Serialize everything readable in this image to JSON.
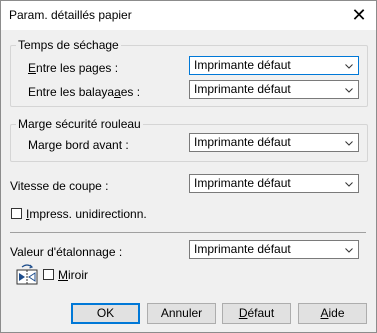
{
  "window": {
    "title": "Param. détaillés papier",
    "close_glyph": "✕"
  },
  "drying": {
    "group_title": "Temps de séchage",
    "between_pages_label": "Entre les pages :",
    "between_pages_value": "Imprimante défaut",
    "between_scans_label": "Entre les balayages :",
    "between_scans_value": "Imprimante défaut"
  },
  "margin": {
    "group_title": "Marge sécurité rouleau",
    "front_edge_label": "Marge bord avant :",
    "front_edge_value": "Imprimante défaut"
  },
  "cut_speed": {
    "label": "Vitesse de coupe :",
    "value": "Imprimante défaut"
  },
  "unidirectional": {
    "label": "Impress. unidirectionn.",
    "checked": false
  },
  "calibration": {
    "label": "Valeur d'étalonnage :",
    "value": "Imprimante défaut"
  },
  "mirror": {
    "label": "Miroir",
    "checked": false,
    "icon": "mirror-icon"
  },
  "buttons": {
    "ok": "OK",
    "cancel": "Annuler",
    "default": "Défaut",
    "help": "Aide"
  },
  "colors": {
    "accent": "#0078d7",
    "dialog_bg": "#f0f0f0"
  }
}
